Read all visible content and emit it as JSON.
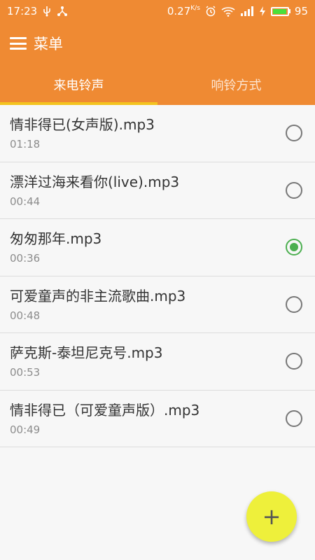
{
  "status_bar": {
    "time": "17:23",
    "speed": "0.27",
    "speed_unit": "K/s",
    "battery": "95",
    "battery_level": 0.95,
    "icons": [
      "usb-icon",
      "share-icon",
      "alarm-icon",
      "wifi-icon",
      "signal-icon",
      "charging-icon",
      "battery-icon"
    ]
  },
  "toolbar": {
    "title": "菜单",
    "menu_icon": "hamburger-menu-icon"
  },
  "tabs": [
    {
      "label": "来电铃声",
      "active": true
    },
    {
      "label": "响铃方式",
      "active": false
    }
  ],
  "ringtones": [
    {
      "title": "情非得已(女声版).mp3",
      "duration": "01:18",
      "selected": false
    },
    {
      "title": "漂洋过海来看你(live).mp3",
      "duration": "00:44",
      "selected": false
    },
    {
      "title": "匆匆那年.mp3",
      "duration": "00:36",
      "selected": true
    },
    {
      "title": "可爱童声的非主流歌曲.mp3",
      "duration": "00:48",
      "selected": false
    },
    {
      "title": "萨克斯-泰坦尼克号.mp3",
      "duration": "00:53",
      "selected": false
    },
    {
      "title": "情非得已（可爱童声版）.mp3",
      "duration": "00:49",
      "selected": false
    }
  ],
  "fab": {
    "label": "+"
  },
  "colors": {
    "accent": "#ef8a33",
    "tab_indicator": "#f4c41f",
    "radio_selected": "#4caf50",
    "fab": "#eef03b"
  }
}
